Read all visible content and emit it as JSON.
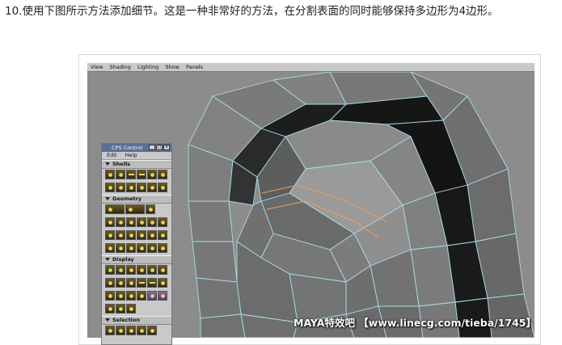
{
  "instruction": "10.使用下图所示方法添加细节。这是一种非常好的方法，在分割表面的同时能够保持多边形为4边形。",
  "viewport_menu": [
    "View",
    "Shading",
    "Lighting",
    "Show",
    "Panels"
  ],
  "cps_panel": {
    "title": "CPS Control",
    "menu": [
      "Edit",
      "Help"
    ],
    "sections": [
      "Shells",
      "Geometry",
      "Display",
      "Selection"
    ]
  },
  "watermark": "MAYA特效吧 【www.linecg.com/tieba/1745】",
  "colors": {
    "mesh_face": "#7d7d7d",
    "wire": "#9fd3e6",
    "background": "#8a8a8a",
    "highlight_edge": "#e8a060"
  },
  "icons": [
    "cps-tool-icon"
  ]
}
